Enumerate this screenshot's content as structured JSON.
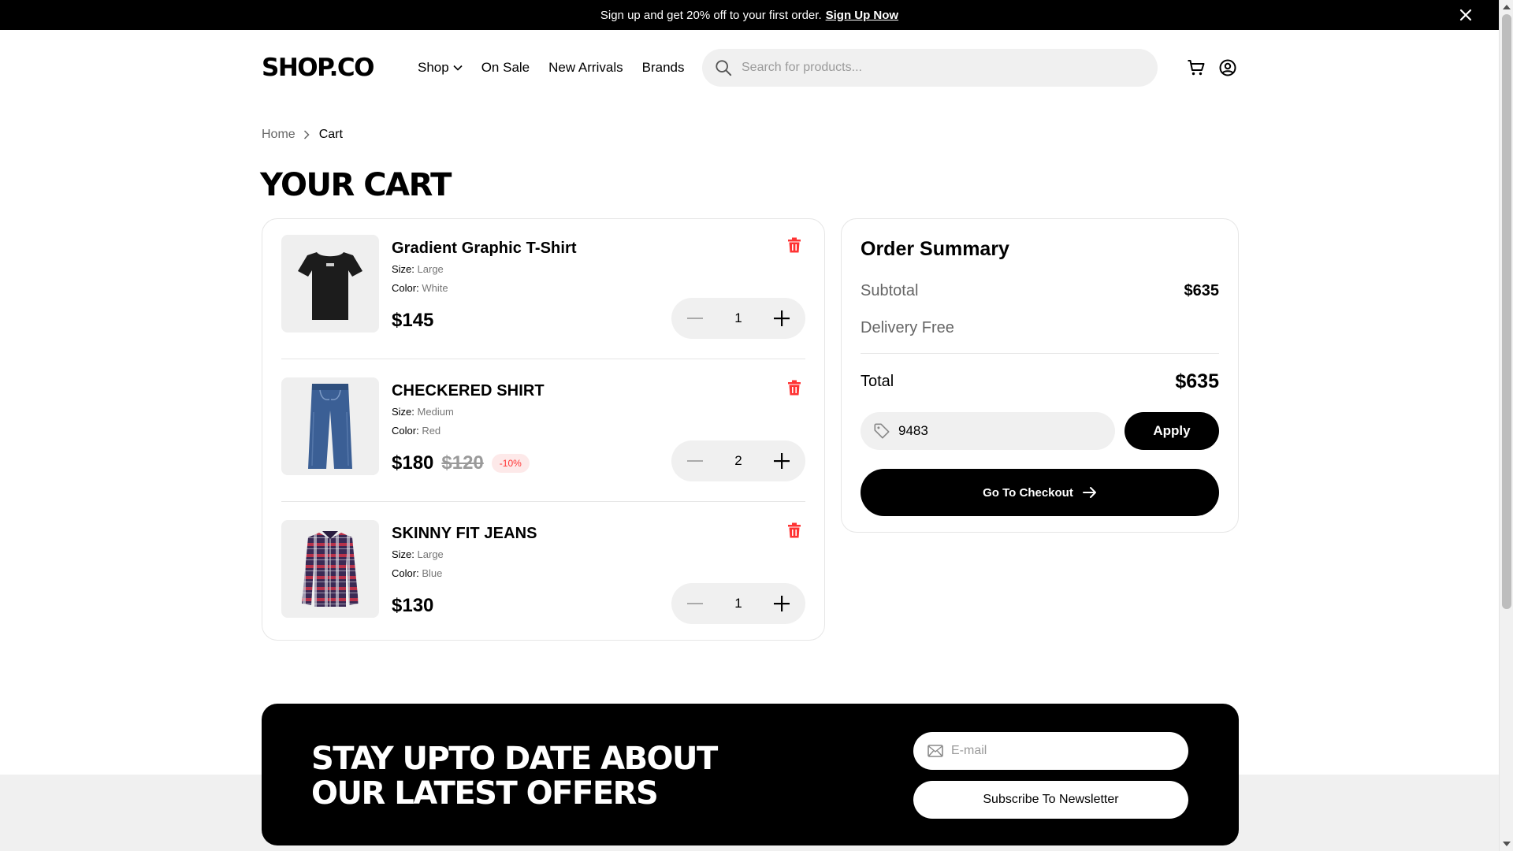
{
  "banner": {
    "text": "Sign up and get 20% off to your first order.",
    "link": "Sign Up Now"
  },
  "header": {
    "logo": "SHOP.CO",
    "nav": [
      "Shop",
      "On Sale",
      "New Arrivals",
      "Brands"
    ],
    "search_placeholder": "Search for products..."
  },
  "breadcrumb": {
    "home": "Home",
    "current": "Cart"
  },
  "page_title": "YOUR CART",
  "cart": {
    "size_label": "Size:",
    "color_label": "Color:",
    "items": [
      {
        "name": "Gradient Graphic T-Shirt",
        "size": "Large",
        "color": "White",
        "price": "$145",
        "old_price": "",
        "discount": "",
        "quantity": "1",
        "image": "tshirt"
      },
      {
        "name": "CHECKERED SHIRT",
        "size": "Medium",
        "color": "Red",
        "price": "$180",
        "old_price": "$120",
        "discount": "-10%",
        "quantity": "2",
        "image": "jeans"
      },
      {
        "name": "SKINNY FIT JEANS",
        "size": "Large",
        "color": "Blue",
        "price": "$130",
        "old_price": "",
        "discount": "",
        "quantity": "1",
        "image": "shirt"
      }
    ]
  },
  "summary": {
    "title": "Order Summary",
    "subtotal_label": "Subtotal",
    "subtotal": "$635",
    "delivery_label": "Delivery Free",
    "total_label": "Total",
    "total": "$635",
    "promo_code": "9483",
    "apply_label": "Apply",
    "checkout_label": "Go To Checkout"
  },
  "newsletter": {
    "line1": "STAY UPTO DATE ABOUT",
    "line2": "OUR LATEST OFFERS",
    "email_placeholder": "E-mail",
    "subscribe_label": "Subscribe To Newsletter"
  },
  "colors": {
    "accent": "#000000",
    "danger": "#ff3333",
    "discount_bg": "#fde9e9",
    "field_bg": "#f0f0f0"
  }
}
